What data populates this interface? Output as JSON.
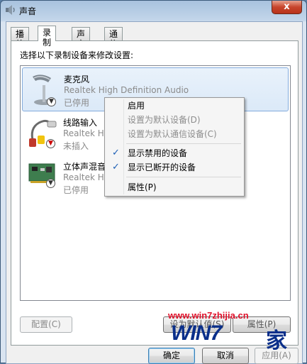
{
  "window": {
    "title": "声音",
    "close_glyph": "x"
  },
  "tabs": [
    {
      "label": "播放",
      "active": false
    },
    {
      "label": "录制",
      "active": true
    },
    {
      "label": "声音",
      "active": false
    },
    {
      "label": "通信",
      "active": false
    }
  ],
  "instruction": "选择以下录制设备来修改设置:",
  "devices": [
    {
      "name": "麦克风",
      "driver": "Realtek High Definition Audio",
      "status": "已停用",
      "icon": "microphone-icon",
      "badge": "disabled-down-arrow"
    },
    {
      "name": "线路输入",
      "driver": "Realtek Hig",
      "status": "未插入",
      "icon": "line-in-icon",
      "badge": "unplugged-red-arrow"
    },
    {
      "name": "立体声混音",
      "driver": "Realtek Hig",
      "status": "已停用",
      "icon": "sound-card-icon",
      "badge": "disabled-down-arrow"
    }
  ],
  "context_menu": {
    "items": [
      {
        "label": "启用",
        "enabled": true,
        "checked": false
      },
      {
        "label": "设置为默认设备(D)",
        "enabled": false,
        "checked": false
      },
      {
        "label": "设置为默认通信设备(C)",
        "enabled": false,
        "checked": false
      },
      {
        "label": "显示禁用的设备",
        "enabled": true,
        "checked": true
      },
      {
        "label": "显示已断开的设备",
        "enabled": true,
        "checked": true
      },
      {
        "label": "属性(P)",
        "enabled": true,
        "checked": false
      }
    ]
  },
  "buttons": {
    "configure": "配置(C)",
    "set_default": "设为默认值(S)",
    "properties": "属性(P)",
    "ok": "确定",
    "cancel": "取消",
    "apply": "应用(A)"
  },
  "watermark": {
    "url": "www.win7zhijia.cn",
    "logo_text": "WIN7",
    "logo_char": "家"
  },
  "colors": {
    "accent": "#1c5fb5",
    "watermark_red": "#e0102a",
    "watermark_blue": "#0a2f8a"
  }
}
